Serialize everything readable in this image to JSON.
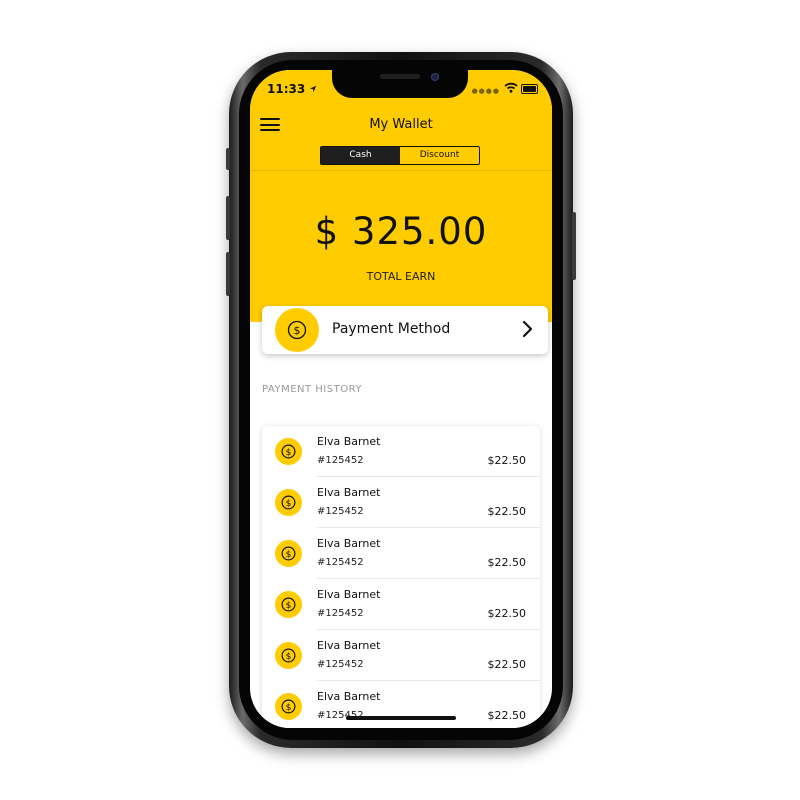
{
  "status_bar": {
    "time": "11:33"
  },
  "header": {
    "title": "My Wallet"
  },
  "tabs": [
    {
      "label": "Cash",
      "active": true
    },
    {
      "label": "Discount",
      "active": false
    }
  ],
  "balance": {
    "amount": "$ 325.00",
    "label": "TOTAL EARN"
  },
  "payment_method": {
    "label": "Payment Method"
  },
  "history": {
    "title": "PAYMENT HISTORY",
    "items": [
      {
        "name": "Elva Barnet",
        "id": "#125452",
        "amount": "$22.50"
      },
      {
        "name": "Elva Barnet",
        "id": "#125452",
        "amount": "$22.50"
      },
      {
        "name": "Elva Barnet",
        "id": "#125452",
        "amount": "$22.50"
      },
      {
        "name": "Elva Barnet",
        "id": "#125452",
        "amount": "$22.50"
      },
      {
        "name": "Elva Barnet",
        "id": "#125452",
        "amount": "$22.50"
      },
      {
        "name": "Elva Barnet",
        "id": "#125452",
        "amount": "$22.50"
      }
    ]
  },
  "colors": {
    "accent": "#FFCC00",
    "dark": "#1f1f1f"
  }
}
